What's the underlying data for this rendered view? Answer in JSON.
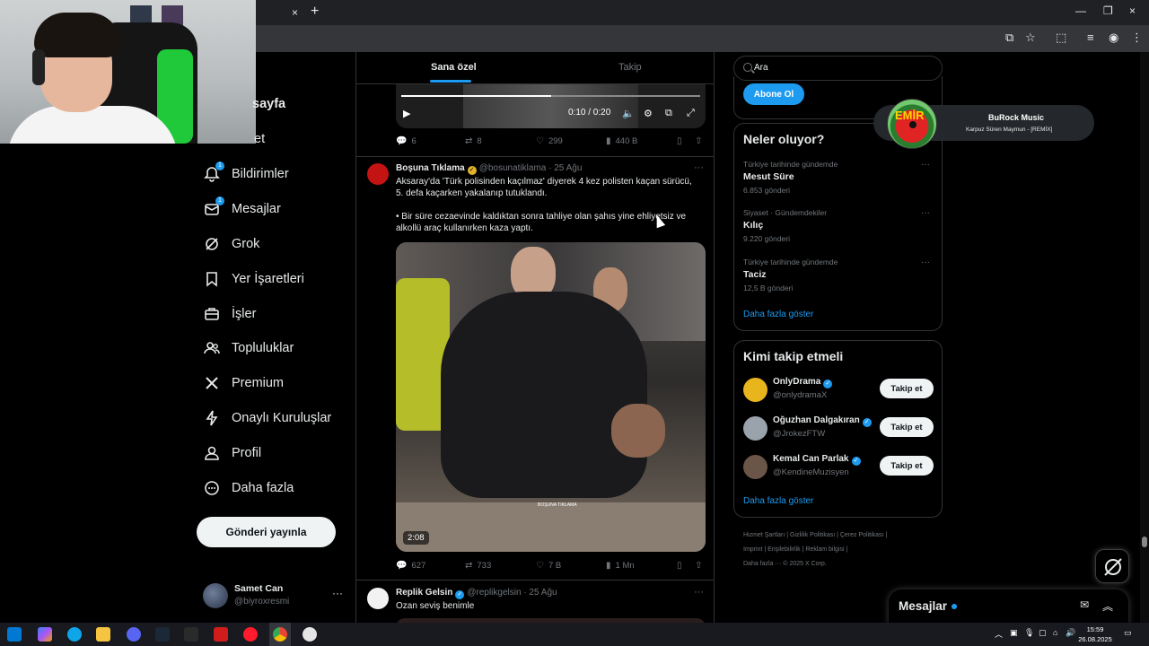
{
  "browser": {
    "tab_close": "×",
    "new_tab": "+",
    "window_controls": [
      "—",
      "❐",
      "×"
    ]
  },
  "feed": {
    "tabs": [
      {
        "label": "Sana özel",
        "active": true
      },
      {
        "label": "Takip",
        "active": false
      }
    ],
    "top_video": {
      "time": "0:10 / 0:20",
      "progress": 0.5,
      "stats": {
        "replies": "6",
        "reposts": "8",
        "likes": "299",
        "views": "440 B"
      }
    },
    "post1": {
      "name": "Boşuna Tıklama",
      "handle": "@bosunatiklama",
      "date": "· 25 Ağu",
      "more": "···",
      "text_line1": "Aksaray'da 'Türk polisinden kaçılmaz' diyerek 4 kez polisten kaçan sürücü,",
      "text_line2": "5. defa kaçarken yakalanıp tutuklandı.",
      "text_line3": "• Bir süre cezaevinde kaldıktan sonra tahliye olan şahıs yine ehliyetsiz ve",
      "text_line4": "alkollü araç kullanırken kaza yaptı.",
      "video_duration": "2:08",
      "watermark": "BOŞUNA TIKLAMA",
      "stats": {
        "replies": "627",
        "reposts": "733",
        "likes": "7 B",
        "views": "1 Mn"
      }
    },
    "post2": {
      "name": "Replik Gelsin",
      "handle": "@replikgelsin",
      "date": "· 25 Ağu",
      "more": "···",
      "text": "Ozan seviş benimle"
    }
  },
  "sidebar": {
    "items": [
      {
        "label": "sayfa",
        "icon": "home-icon"
      },
      {
        "label": "et",
        "icon": "explore-icon"
      },
      {
        "label": "Bildirimler",
        "icon": "bell-icon",
        "badge": "1"
      },
      {
        "label": "Mesajlar",
        "icon": "mail-icon",
        "badge": "1"
      },
      {
        "label": "Grok",
        "icon": "grok-icon"
      },
      {
        "label": "Yer İşaretleri",
        "icon": "bookmark-icon"
      },
      {
        "label": "İşler",
        "icon": "briefcase-icon"
      },
      {
        "label": "Topluluklar",
        "icon": "people-icon"
      },
      {
        "label": "Premium",
        "icon": "x-logo-icon"
      },
      {
        "label": "Onaylı Kuruluşlar",
        "icon": "lightning-icon"
      },
      {
        "label": "Profil",
        "icon": "person-icon"
      },
      {
        "label": "Daha fazla",
        "icon": "more-circle-icon"
      }
    ],
    "post_button": "Gönderi yayınla",
    "account": {
      "name": "Samet Can",
      "handle": "@biyroxresmi",
      "more": "···"
    }
  },
  "right": {
    "search_placeholder": "Ara",
    "subscribe_button": "Abone Ol",
    "trends": {
      "title": "Neler oluyor?",
      "items": [
        {
          "context": "Türkiye tarihinde gündemde",
          "name": "Mesut Süre",
          "count": "6.853 gönderi"
        },
        {
          "context": "Siyaset · Gündemdekiler",
          "name": "Kılıç",
          "count": "9.220 gönderi"
        },
        {
          "context": "Türkiye tarihinde gündemde",
          "name": "Taciz",
          "count": "12,5 B gönderi"
        }
      ],
      "show_more": "Daha fazla göster"
    },
    "who_to_follow": {
      "title": "Kimi takip etmeli",
      "items": [
        {
          "name": "OnlyDrama",
          "handle": "@onlydramaX",
          "button": "Takip et"
        },
        {
          "name": "Oğuzhan Dalgakıran",
          "handle": "@JrokezFTW",
          "button": "Takip et"
        },
        {
          "name": "Kemal Can Parlak",
          "handle": "@KendineMuzisyen",
          "button": "Takip et"
        }
      ],
      "show_more": "Daha fazla göster"
    },
    "footer": {
      "line1": "Hizmet Şartları  |  Gizlilik Politikası  |  Çerez Politikası  |",
      "line2": "Imprint  |  Erişilebilirlik  |  Reklam bilgisi  |",
      "line3": "Daha fazla ···   © 2025 X Corp."
    }
  },
  "music": {
    "title": "BuRock Music",
    "subtitle": "Karpuz Süren Maymun - [REMİX]",
    "art_text": "EMİR"
  },
  "messages_drawer": {
    "title": "Mesajlar"
  },
  "taskbar": {
    "time": "15:59",
    "date": "26.08.2025"
  }
}
